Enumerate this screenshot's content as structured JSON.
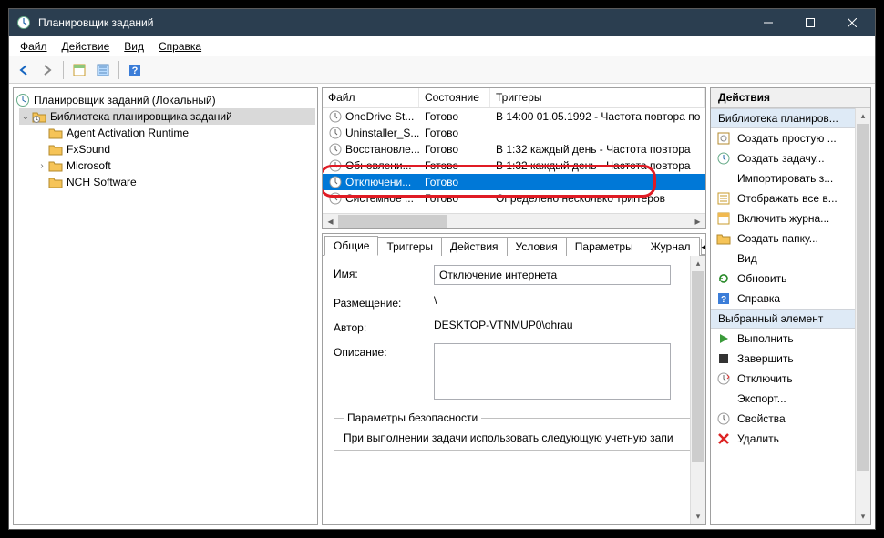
{
  "window": {
    "title": "Планировщик заданий"
  },
  "menu": {
    "file": "Файл",
    "action": "Действие",
    "view": "Вид",
    "help": "Справка"
  },
  "tree": {
    "root": "Планировщик заданий (Локальный)",
    "lib": "Библиотека планировщика заданий",
    "children": [
      "Agent Activation Runtime",
      "FxSound",
      "Microsoft",
      "NCH Software"
    ]
  },
  "list": {
    "cols": {
      "file": "Файл",
      "state": "Состояние",
      "triggers": "Триггеры"
    },
    "rows": [
      {
        "name": "OneDrive St...",
        "state": "Готово",
        "trigger": "В 14:00 01.05.1992 - Частота повтора по"
      },
      {
        "name": "Uninstaller_S...",
        "state": "Готово",
        "trigger": ""
      },
      {
        "name": "Восстановле...",
        "state": "Готово",
        "trigger": "В 1:32 каждый день - Частота повтора"
      },
      {
        "name": "Обновлени...",
        "state": "Готово",
        "trigger": "В 1:32 каждый день - Частота повтора"
      },
      {
        "name": "Отключени...",
        "state": "Готово",
        "trigger": ""
      },
      {
        "name": "Системное ...",
        "state": "Готово",
        "trigger": "Определено несколько триггеров"
      }
    ]
  },
  "tabs": {
    "general": "Общие",
    "triggers": "Триггеры",
    "actions": "Действия",
    "conditions": "Условия",
    "settings": "Параметры",
    "history": "Журнал"
  },
  "form": {
    "name_lbl": "Имя:",
    "name_val": "Отключение интернета",
    "loc_lbl": "Размещение:",
    "loc_val": "\\",
    "author_lbl": "Автор:",
    "author_val": "DESKTOP-VTNMUP0\\ohrau",
    "desc_lbl": "Описание:",
    "desc_val": "",
    "security_legend": "Параметры безопасности",
    "security_text": "При выполнении задачи использовать следующую учетную запи"
  },
  "actions": {
    "header": "Действия",
    "section1": "Библиотека планиров...",
    "items1": [
      "Создать простую ...",
      "Создать задачу...",
      "Импортировать з...",
      "Отображать все в...",
      "Включить журна...",
      "Создать папку..."
    ],
    "view": "Вид",
    "refresh": "Обновить",
    "help": "Справка",
    "section2": "Выбранный элемент",
    "items2": [
      "Выполнить",
      "Завершить",
      "Отключить",
      "Экспорт..."
    ],
    "props": "Свойства",
    "delete": "Удалить"
  }
}
